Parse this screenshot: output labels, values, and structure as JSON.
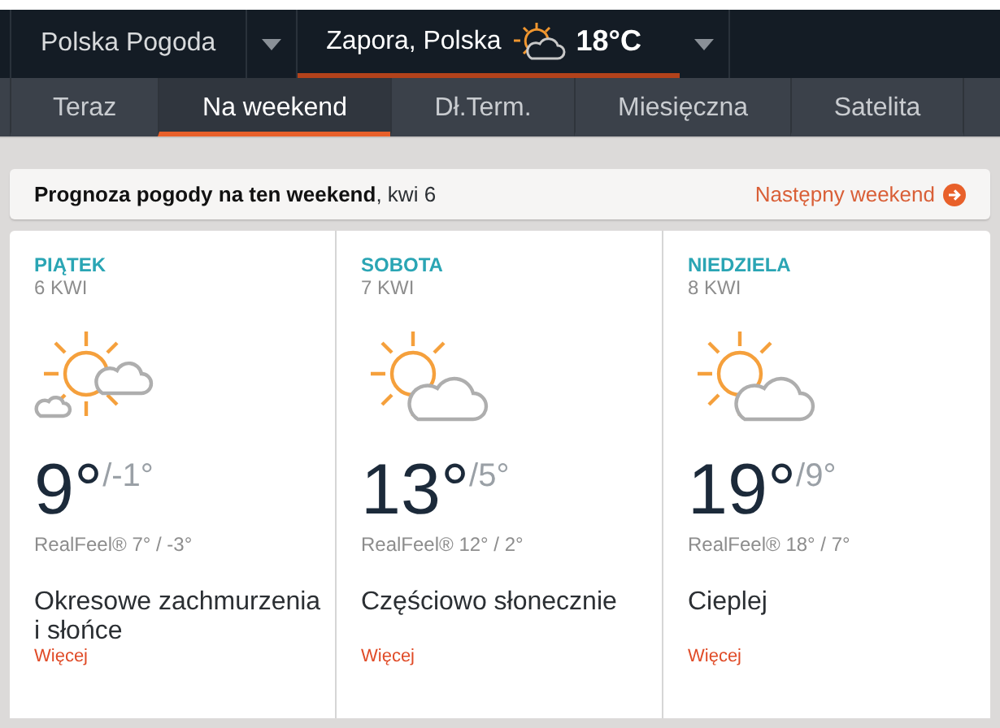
{
  "header": {
    "region": "Polska Pogoda",
    "location": "Zapora, Polska",
    "temperature": "18°C"
  },
  "tabs": [
    {
      "label": "Teraz",
      "selected": false
    },
    {
      "label": "Na weekend",
      "selected": true
    },
    {
      "label": "Dł.Term.",
      "selected": false
    },
    {
      "label": "Miesięczna",
      "selected": false
    },
    {
      "label": "Satelita",
      "selected": false
    }
  ],
  "banner": {
    "title": "**Prognoza pogody na ten weekend**, kwi 6",
    "link": "Następny weekend"
  },
  "days": [
    {
      "day": "PIĄTEK",
      "date": "6 KWI",
      "kind": "sun-clouds",
      "high": "9°",
      "low": "/-1°",
      "realfeel": "RealFeel® 7° / -3°",
      "condition": "Okresowe zachmurzenia i słońce",
      "more": "Więcej"
    },
    {
      "day": "SOBOTA",
      "date": "7 KWI",
      "kind": "sun-cloud",
      "high": "13°",
      "low": "/5°",
      "realfeel": "RealFeel® 12° / 2°",
      "condition": "Częściowo słonecznie",
      "more": "Więcej"
    },
    {
      "day": "NIEDZIELA",
      "date": "8 KWI",
      "kind": "sun-cloud",
      "high": "19°",
      "low": "/9°",
      "realfeel": "RealFeel® 18° / 7°",
      "condition": "Cieplej",
      "more": "Więcej"
    }
  ]
}
